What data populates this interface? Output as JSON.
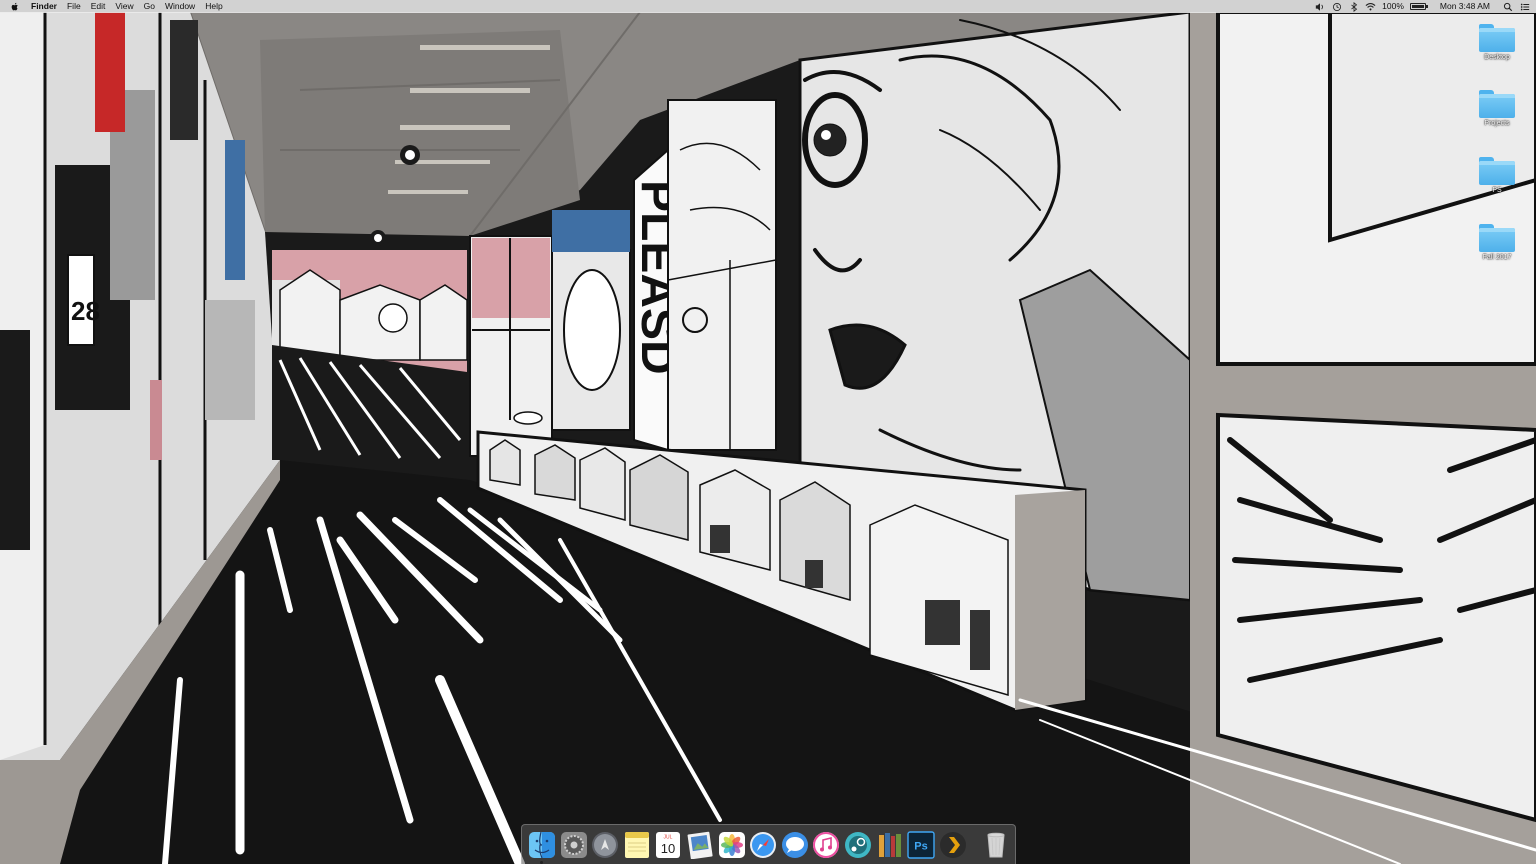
{
  "menubar": {
    "app_name": "Finder",
    "menus": [
      "File",
      "Edit",
      "View",
      "Go",
      "Window",
      "Help"
    ],
    "battery_percent": "100%",
    "clock": "Mon 3:48 AM"
  },
  "desktop": {
    "icons": [
      {
        "label": "Desktop"
      },
      {
        "label": "Projects"
      },
      {
        "label": "PS"
      },
      {
        "label": "Fall 2017"
      }
    ]
  },
  "dock": {
    "apps": [
      {
        "name": "finder-icon",
        "running": true
      },
      {
        "name": "system-preferences-icon",
        "running": false
      },
      {
        "name": "launchpad-icon",
        "running": false
      },
      {
        "name": "notes-icon",
        "running": false
      },
      {
        "name": "calendar-icon",
        "running": false,
        "month": "JUL",
        "day": "10"
      },
      {
        "name": "preview-icon",
        "running": false
      },
      {
        "name": "photos-icon",
        "running": false
      },
      {
        "name": "safari-icon",
        "running": false
      },
      {
        "name": "messages-icon",
        "running": false
      },
      {
        "name": "itunes-icon",
        "running": false
      },
      {
        "name": "steam-icon",
        "running": false
      },
      {
        "name": "ibooks-icon",
        "running": false
      },
      {
        "name": "photoshop-icon",
        "running": false,
        "label": "Ps"
      },
      {
        "name": "plex-icon",
        "running": false
      }
    ],
    "trash": {
      "name": "trash-icon"
    }
  },
  "colors": {
    "menubar_bg": "#ececec",
    "folder_blue": "#5fbdf0",
    "wall_pink": "#d9a2a9",
    "floor_black": "#151515"
  }
}
